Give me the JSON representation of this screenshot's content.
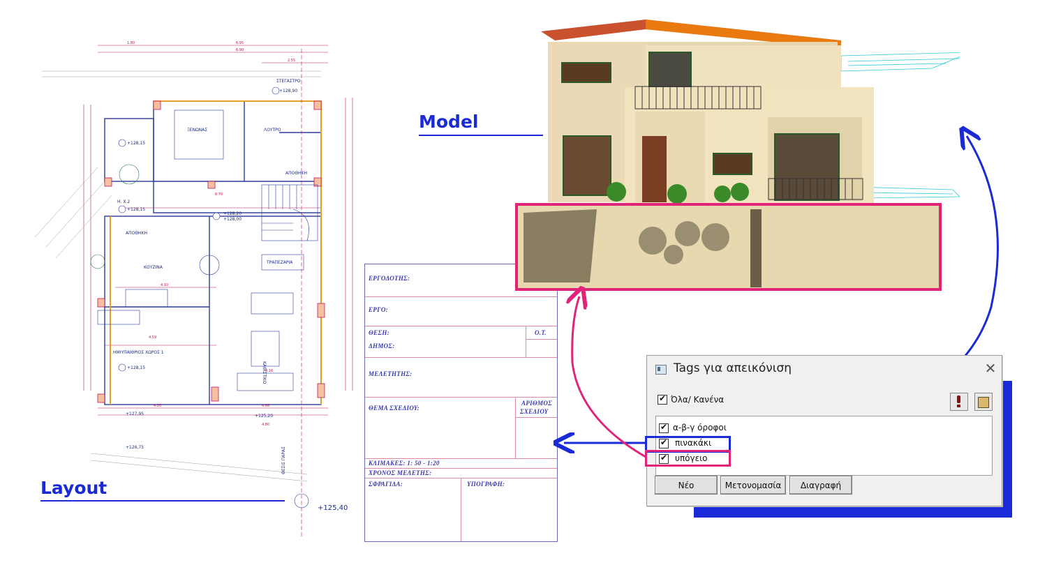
{
  "labels": {
    "model": "Model",
    "layout": "Layout"
  },
  "floorplan": {
    "rooms": {
      "guest": "ΞΕΝΩΝΑΣ",
      "bath": "ΛΟΥΤΡΟ",
      "storage1": "ΑΠΟΘΗΚΗ",
      "storage2": "ΑΠΟΘΗΚΗ",
      "kitchen": "ΚΟΥΖΙΝΑ",
      "dining": "ΤΡΑΠΕΖΑΡΙΑ",
      "semi": "ΗΜΙΥΠΑΙΘΡΙΟΣ ΧΩΡΟΣ 1",
      "cabinet": "ΚΑΘΙΣΤΙΚΟ",
      "roof": "ΣΤΕΓΑΣΤΡΟ",
      "hx": "Η. Χ.2",
      "street": "ΘΕΣΙΣ ΠΑΡΑΣ"
    },
    "levels": {
      "l1": "+128,90",
      "l2": "+128,15",
      "l3": "+128,15",
      "l4": "+128,20",
      "l5": "+128,00",
      "l6": "+128,15",
      "l7": "+127,95",
      "l8": "+125,20",
      "l9": "+126,75",
      "base": "+125,40"
    },
    "dims": {
      "d1": "1.80",
      "d2": "6.95",
      "d3": "6.90",
      "d4": "2.55",
      "d5": "4.59",
      "d6": "4.20",
      "d7": "4.66",
      "d8": "4.10",
      "d9": "4.16",
      "d10": "8.70",
      "d11": "4.80"
    }
  },
  "titleblock": {
    "owner": "ΕΡΓΟΔΟΤΗΣ:",
    "project": "ΕΡΓΟ:",
    "position": "ΘΕΣΗ:",
    "ot": "Ο.Τ.",
    "municipality": "ΔΗΜΟΣ:",
    "designer": "ΜΕΛΕΤΗΤΗΣ:",
    "subject": "ΘΕΜΑ ΣΧΕΔΙΟΥ:",
    "number": "ΑΡΙΘΜΟΣ",
    "number2": "ΣΧΕΔΙΟΥ",
    "scales": "ΚΛΙΜΑΚΕΣ: 1: 50  - 1:20",
    "time": "ΧΡΟΝΟΣ ΜΕΛΕΤΗΣ:",
    "stamp": "ΣΦΡΑΓΙΔΑ:",
    "signature": "ΥΠΟΓΡΑΦΗ:"
  },
  "dialog": {
    "title": "Tags για απεικόνιση",
    "all_none": "Όλα/ Κανένα",
    "items": [
      {
        "label": "α-β-γ όροφοι",
        "checked": true
      },
      {
        "label": "πινακάκι",
        "checked": true
      },
      {
        "label": "υπόγειο",
        "checked": true
      }
    ],
    "buttons": {
      "new": "Νέο",
      "rename": "Μετονομασία",
      "delete": "Διαγραφή"
    }
  },
  "colors": {
    "accent_blue": "#1a2ad6",
    "accent_pink": "#e0247a",
    "plan_line": "#2a3a9a",
    "plan_dim": "#c0145a"
  }
}
